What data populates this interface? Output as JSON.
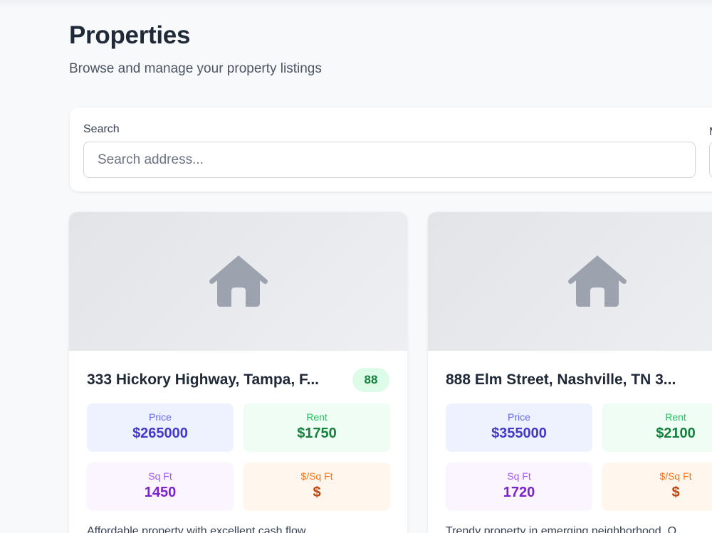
{
  "header": {
    "title": "Properties",
    "subtitle": "Browse and manage your property listings"
  },
  "filters": {
    "search_label": "Search",
    "search_placeholder": "Search address...",
    "search_value": "",
    "second_label": "M"
  },
  "properties": [
    {
      "address": "333 Hickory Highway, Tampa, F...",
      "score": "88",
      "price_label": "Price",
      "price": "$265000",
      "rent_label": "Rent",
      "rent": "$1750",
      "sqft_label": "Sq Ft",
      "sqft": "1450",
      "ppsf_label": "$/Sq Ft",
      "ppsf": "$",
      "description": "Affordable property with excellent cash flow"
    },
    {
      "address": "888 Elm Street, Nashville, TN 3...",
      "price_label": "Price",
      "price": "$355000",
      "rent_label": "Rent",
      "rent": "$2100",
      "sqft_label": "Sq Ft",
      "sqft": "1720",
      "ppsf_label": "$/Sq Ft",
      "ppsf": "$",
      "description": "Trendy property in emerging neighborhood. O"
    }
  ],
  "icons": {
    "placeholder": "house-icon"
  },
  "colors": {
    "house_icon": "#9ca3af",
    "score_bg": "#dcfce7",
    "score_text": "#15803d"
  }
}
